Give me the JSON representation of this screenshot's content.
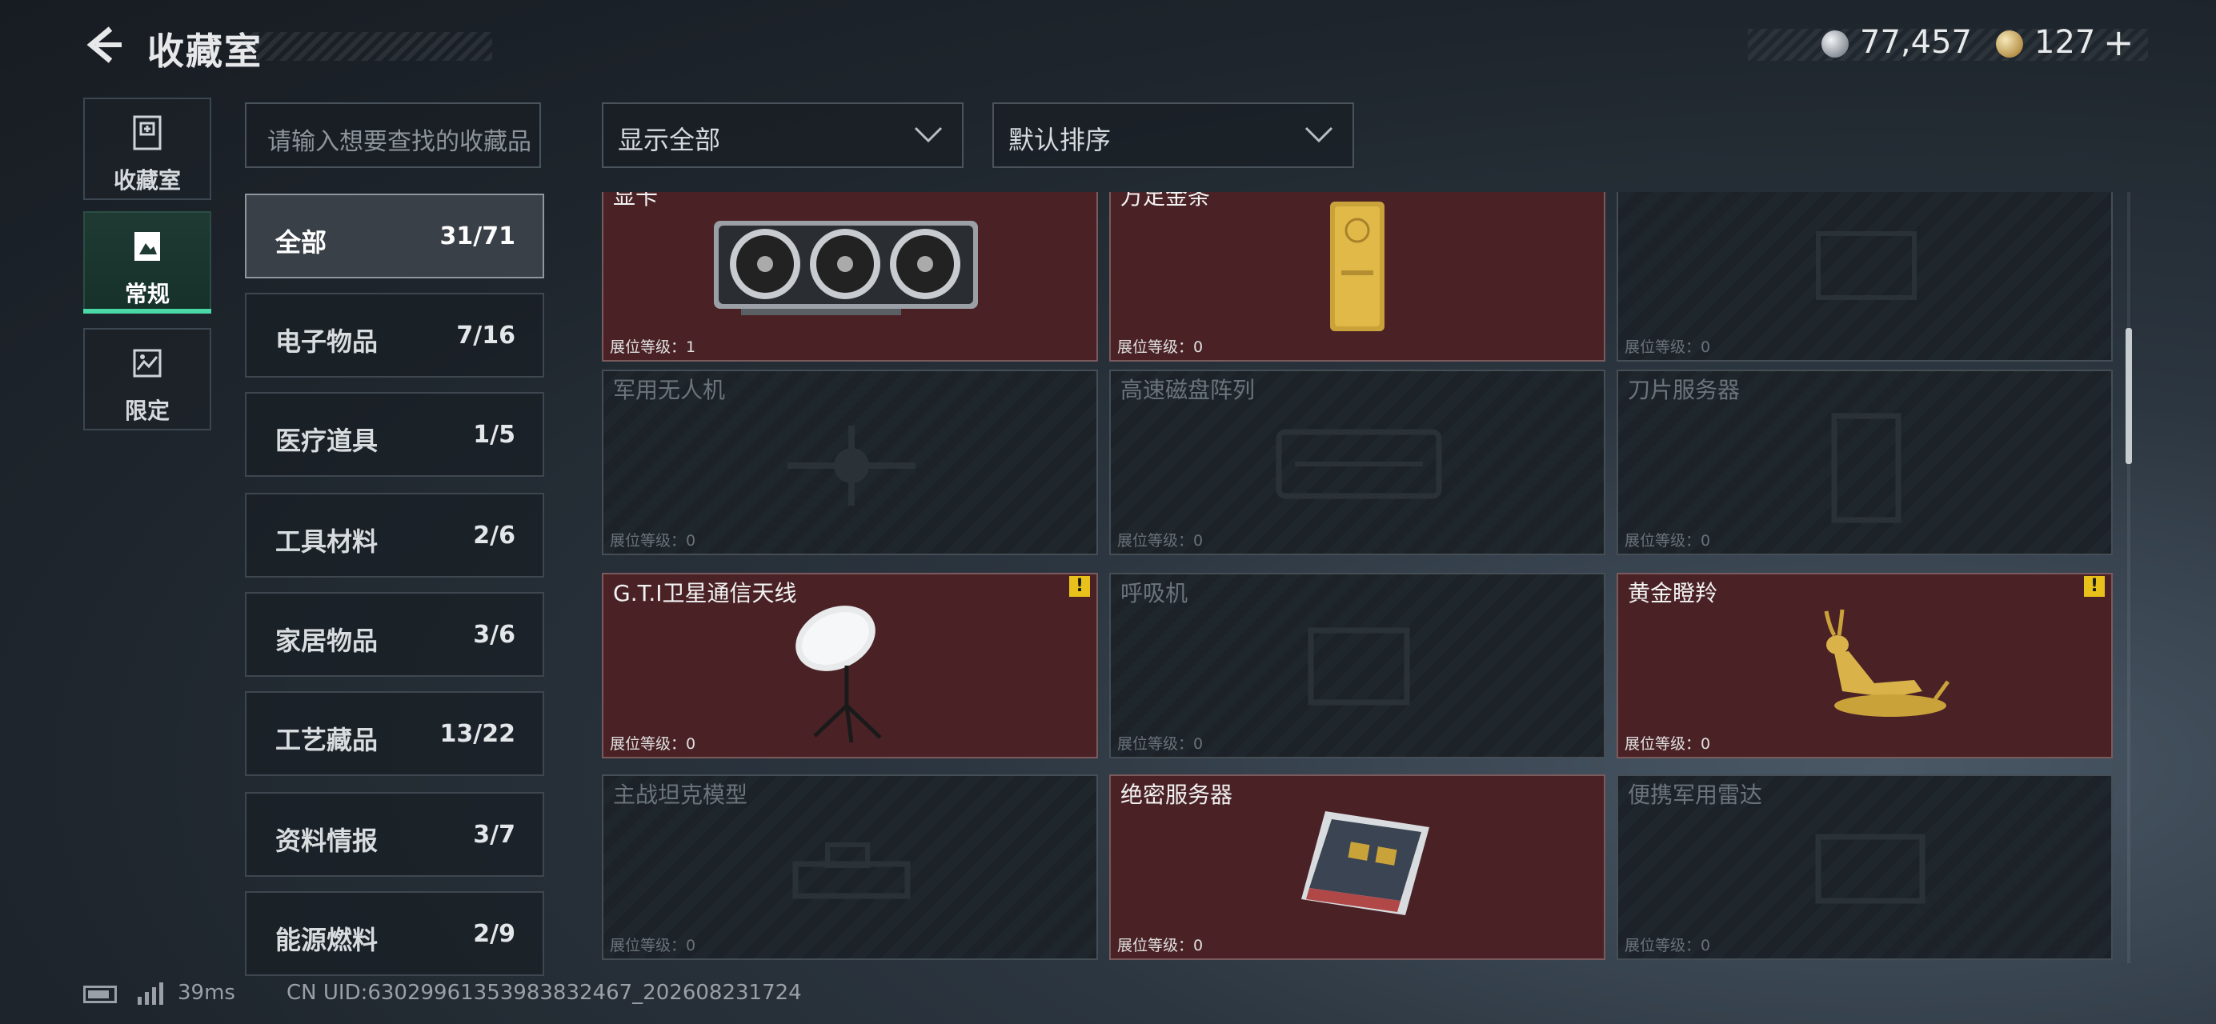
{
  "header": {
    "title": "收藏室",
    "currency1": "77,457",
    "currency2": "127",
    "plus": "+",
    "currency_icons": [
      "silver-coin-icon",
      "gold-coin-icon"
    ]
  },
  "nav": [
    {
      "label": "收藏室",
      "icon": "collection-room-icon",
      "active": false
    },
    {
      "label": "常规",
      "icon": "regular-icon",
      "active": true
    },
    {
      "label": "限定",
      "icon": "limited-icon",
      "active": false
    }
  ],
  "search": {
    "placeholder": "请输入想要查找的收藏品"
  },
  "filters": {
    "display": "显示全部",
    "sort": "默认排序"
  },
  "categories": [
    {
      "name": "全部",
      "count": "31/71",
      "active": true
    },
    {
      "name": "电子物品",
      "count": "7/16"
    },
    {
      "name": "医疗道具",
      "count": "1/5"
    },
    {
      "name": "工具材料",
      "count": "2/6"
    },
    {
      "name": "家居物品",
      "count": "3/6"
    },
    {
      "name": "工艺藏品",
      "count": "13/22"
    },
    {
      "name": "资料情报",
      "count": "3/7"
    },
    {
      "name": "能源燃料",
      "count": "2/9"
    }
  ],
  "level_label": "展位等级：",
  "cards": [
    {
      "name": "显卡",
      "level": "1",
      "collected": true,
      "icon": "graphics-card-icon"
    },
    {
      "name": "万足金条",
      "level": "0",
      "collected": true,
      "icon": "gold-bar-icon"
    },
    {
      "name": "",
      "level": "0",
      "collected": false,
      "icon": "locked-item-icon"
    },
    {
      "name": "军用无人机",
      "level": "0",
      "collected": false,
      "icon": "drone-icon"
    },
    {
      "name": "高速磁盘阵列",
      "level": "0",
      "collected": false,
      "icon": "disk-array-icon"
    },
    {
      "name": "刀片服务器",
      "level": "0",
      "collected": false,
      "icon": "blade-server-icon"
    },
    {
      "name": "G.T.I卫星通信天线",
      "level": "0",
      "collected": true,
      "alert": true,
      "icon": "satellite-dish-icon"
    },
    {
      "name": "呼吸机",
      "level": "0",
      "collected": false,
      "icon": "ventilator-icon"
    },
    {
      "name": "黄金瞪羚",
      "level": "0",
      "collected": true,
      "alert": true,
      "icon": "golden-gazelle-icon"
    },
    {
      "name": "主战坦克模型",
      "level": "0",
      "collected": false,
      "icon": "tank-model-icon"
    },
    {
      "name": "绝密服务器",
      "level": "0",
      "collected": true,
      "icon": "secret-server-icon"
    },
    {
      "name": "便携军用雷达",
      "level": "0",
      "collected": false,
      "icon": "radar-icon"
    }
  ],
  "footer": {
    "ping": "39ms",
    "uid": "CN UID:6302996135398383​2467_202608231724"
  },
  "colors": {
    "accent": "#49d8a6",
    "collected_card": "#4a2226",
    "alert": "#e8c21a"
  }
}
